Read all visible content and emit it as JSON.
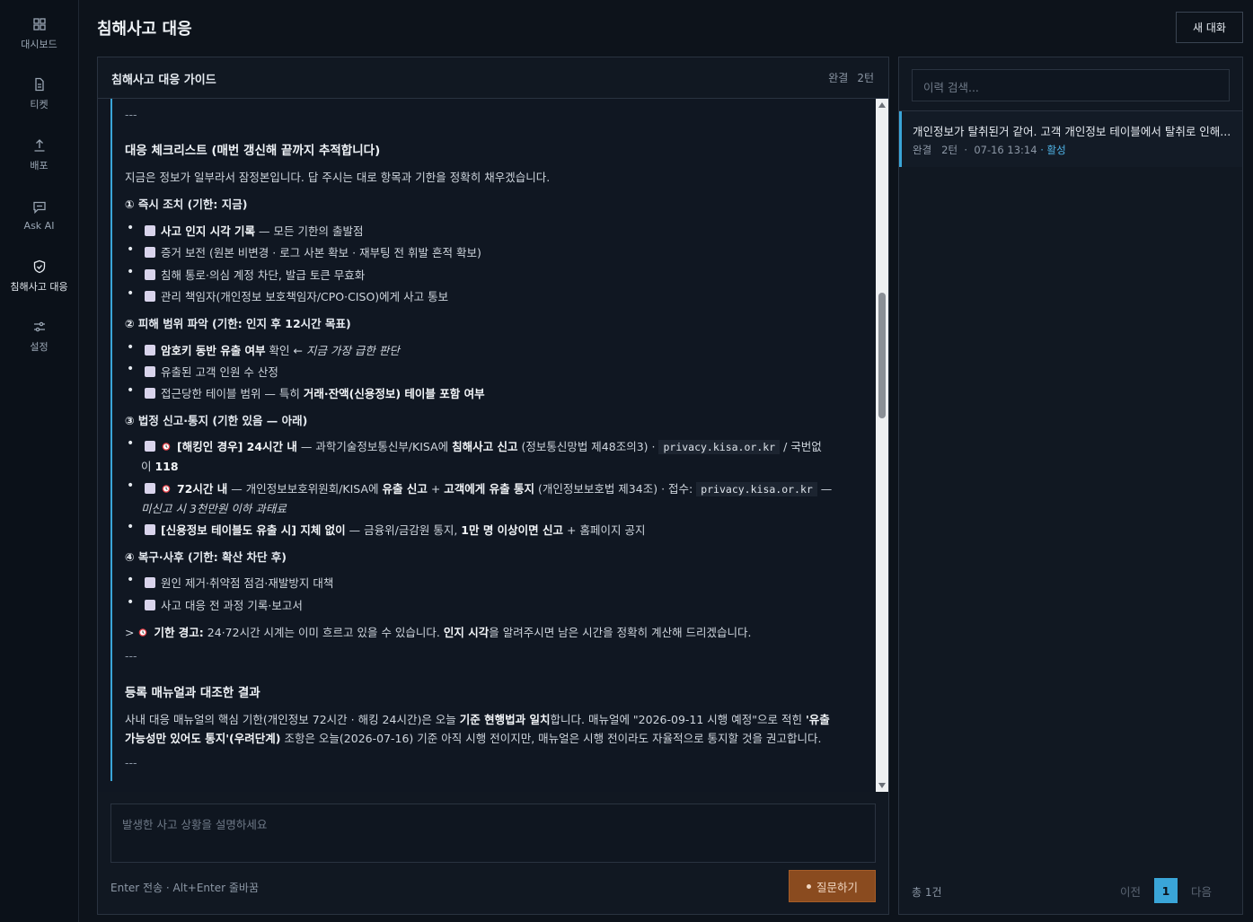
{
  "sidebar": {
    "items": [
      {
        "label": "대시보드",
        "icon": "dashboard-icon"
      },
      {
        "label": "티켓",
        "icon": "ticket-icon"
      },
      {
        "label": "배포",
        "icon": "deploy-icon"
      },
      {
        "label": "Ask AI",
        "icon": "chat-icon"
      },
      {
        "label": "침해사고 대응",
        "icon": "shield-icon",
        "active": true
      },
      {
        "label": "설정",
        "icon": "settings-icon"
      }
    ]
  },
  "header": {
    "title": "침해사고 대응",
    "new_chat": "새 대화"
  },
  "chat": {
    "title": "침해사고 대응 가이드",
    "status": "완결",
    "turns": "2턴",
    "content": {
      "hr": "---",
      "h_checklist": "대응 체크리스트 (매번 갱신해 끝까지 추적합니다)",
      "p_intro": "지금은 정보가 일부라서 잠정본입니다. 답 주시는 대로 항목과 기한을 정확히 채우겠습니다.",
      "s1": "① 즉시 조치 (기한: 지금)",
      "s1_i1_b": "사고 인지 시각 기록",
      "s1_i1_t": " — 모든 기한의 출발점",
      "s1_i2": "증거 보전 (원본 비변경 · 로그 사본 확보 · 재부팅 전 휘발 흔적 확보)",
      "s1_i3": "침해 통로·의심 계정 차단, 발급 토큰 무효화",
      "s1_i4": "관리 책임자(개인정보 보호책임자/CPO·CISO)에게 사고 통보",
      "s2": "② 피해 범위 파악 (기한: 인지 후 12시간 목표)",
      "s2_i1_b": "암호키 동반 유출 여부",
      "s2_i1_t": " 확인 ← ",
      "s2_i1_i": "지금 가장 급한 판단",
      "s2_i2": "유출된 고객 인원 수 산정",
      "s2_i3_t": "접근당한 테이블 범위 — 특히 ",
      "s2_i3_b": "거래·잔액(신용정보) 테이블 포함 여부",
      "s3": "③ 법정 신고·통지 (기한 있음 — 아래)",
      "s3_i1_b1": "[해킹인 경우] 24시간 내",
      "s3_i1_t1": " — 과학기술정보통신부/KISA에 ",
      "s3_i1_b2": "침해사고 신고",
      "s3_i1_t2": " (정보통신망법 제48조의3) · ",
      "s3_i1_code": "privacy.kisa.or.kr",
      "s3_i1_t3": " / 국번없",
      "s3_i1_t4": "이 ",
      "s3_i1_b3": "118",
      "s3_i2_b1": "72시간 내",
      "s3_i2_t1": " — 개인정보보호위원회/KISA에 ",
      "s3_i2_b2": "유출 신고",
      "s3_i2_t2": " + ",
      "s3_i2_b3": "고객에게 유출 통지",
      "s3_i2_t3": " (개인정보보호법 제34조) · 접수: ",
      "s3_i2_code": "privacy.kisa.or.kr",
      "s3_i2_t4": " —",
      "s3_i2_i": "미신고 시 3천만원 이하 과태료",
      "s3_i3_b1": "[신용정보 테이블도 유출 시] 지체 없이",
      "s3_i3_t1": " — 금융위/금감원 통지, ",
      "s3_i3_b2": "1만 명 이상이면 신고",
      "s3_i3_t2": " + 홈페이지 공지",
      "s4": "④ 복구·사후 (기한: 확산 차단 후)",
      "s4_i1": "원인 제거·취약점 점검·재발방지 대책",
      "s4_i2": "사고 대응 전 과정 기록·보고서",
      "q_prefix": "> ",
      "q_b1": "기한 경고:",
      "q_t1": " 24·72시간 시계는 이미 흐르고 있을 수 있습니다. ",
      "q_b2": "인지 시각",
      "q_t2": "을 알려주시면 남은 시간을 정확히 계산해 드리겠습니다.",
      "h_result": "등록 매뉴얼과 대조한 결과",
      "r1_t1": "사내 대응 매뉴얼의 핵심 기한(개인정보 72시간 · 해킹 24시간)은 오늘 ",
      "r1_b1": "기준 현행법과 일치",
      "r1_t2": "합니다. 매뉴얼에 \"2026-09-11 시행 예정\"으로 적힌 ",
      "r1_b2": "'유출",
      "r2_b1": "가능성만 있어도 통지'(우려단계)",
      "r2_t1": " 조항은 오늘(2026-07-16) 기준 아직 시행 전이지만, 매뉴얼은 시행 전이라도 자율적으로 통지할 것을 권고합니다."
    },
    "composer_placeholder": "발생한 사고 상황을 설명하세요",
    "hint": "Enter 전송 · Alt+Enter 줄바꿈",
    "ask_label": "질문하기"
  },
  "history": {
    "search_placeholder": "이력 검색...",
    "items": [
      {
        "title": "개인정보가 탈취된거 같어. 고객 개인정보 테이블에서 탈취로 인해...",
        "status": "완결",
        "turns": "2턴",
        "sep": "·",
        "time": "07-16 13:14",
        "active": "· 활성"
      }
    ],
    "total": "총 1건",
    "prev": "이전",
    "page": "1",
    "next": "다음"
  },
  "colors": {
    "accent": "#3aa5d8",
    "ask_button": "#8a4b1f",
    "background": "#0d131b"
  }
}
